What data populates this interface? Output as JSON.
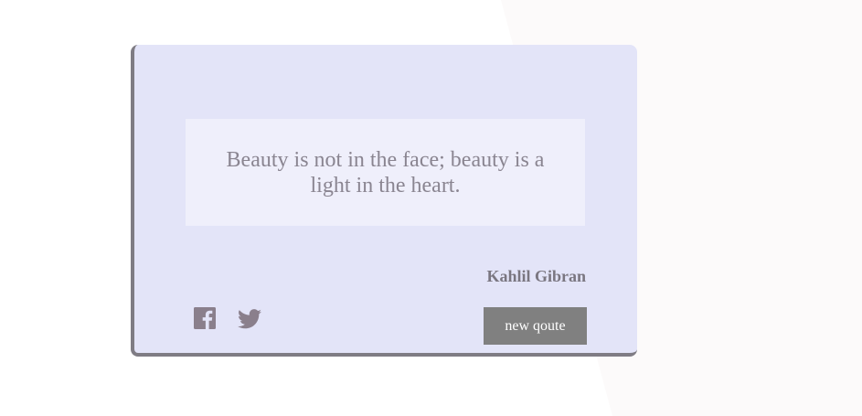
{
  "quote": {
    "text": "Beauty is not in the face; beauty is a light in the heart.",
    "author": "Kahlil Gibran"
  },
  "actions": {
    "new_quote_label": "new qoute",
    "share_facebook_icon": "facebook-icon",
    "share_twitter_icon": "twitter-icon"
  },
  "colors": {
    "card_background": "#e3e4f8",
    "quote_background": "#efeffb",
    "card_shadow": "#7f7c84",
    "button_background": "#808080",
    "icon_color": "#8a7f8c",
    "page_background_accent": "#fcfafa"
  }
}
